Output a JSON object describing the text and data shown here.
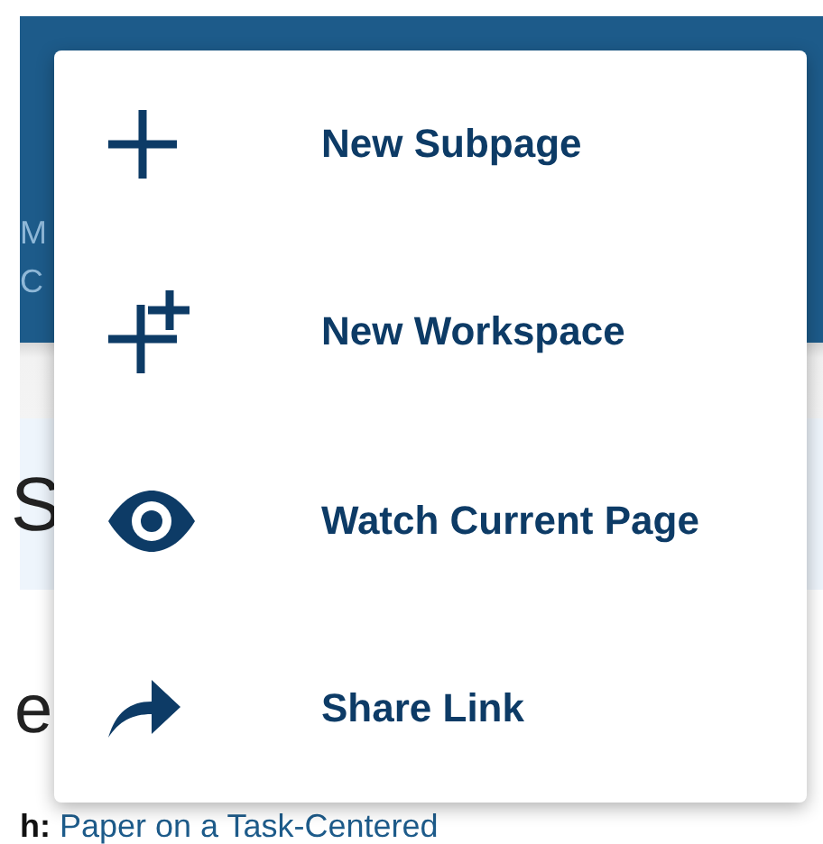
{
  "page": {
    "header_lines": [
      "M",
      "C"
    ],
    "heading": "S",
    "heading_2": "e",
    "paragraph": {
      "label": "h:",
      "link": "Paper on a Task-Centered"
    }
  },
  "menu": {
    "items": [
      {
        "label": "New Subpage"
      },
      {
        "label": "New Workspace"
      },
      {
        "label": "Watch Current Page"
      },
      {
        "label": "Share Link"
      }
    ]
  }
}
